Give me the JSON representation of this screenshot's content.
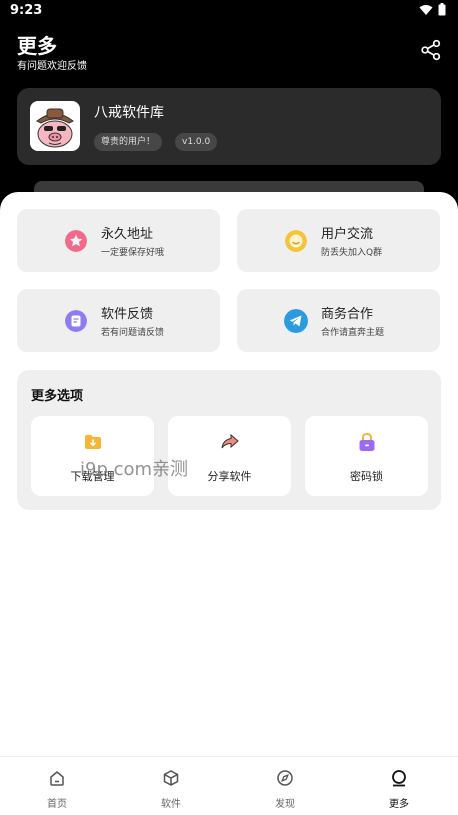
{
  "status_bar": {
    "time": "9:23"
  },
  "header": {
    "title": "更多",
    "subtitle": "有问题欢迎反馈"
  },
  "profile": {
    "name": "八戒软件库",
    "badge": "尊贵的用户！",
    "version": "v1.0.0"
  },
  "features": [
    {
      "title": "永久地址",
      "subtitle": "一定要保存好哦",
      "icon": "star-icon",
      "color": "#f06a8c"
    },
    {
      "title": "用户交流",
      "subtitle": "防丢失加入Q群",
      "icon": "smile-icon",
      "color": "#f3c43c"
    },
    {
      "title": "软件反馈",
      "subtitle": "若有问题请反馈",
      "icon": "feedback-icon",
      "color": "#8e7cf0"
    },
    {
      "title": "商务合作",
      "subtitle": "合作请直奔主题",
      "icon": "telegram-icon",
      "color": "#2a9be0"
    }
  ],
  "more_options": {
    "title": "更多选项",
    "items": [
      {
        "label": "下载管理",
        "icon": "download-folder-icon",
        "color": "#f5b638"
      },
      {
        "label": "分享软件",
        "icon": "share-arrow-icon",
        "color": "#ef8b7f"
      },
      {
        "label": "密码锁",
        "icon": "lock-icon",
        "color": "#9b6cf0"
      }
    ]
  },
  "watermark": "i9p.com亲测",
  "bottom_nav": [
    {
      "label": "首页",
      "icon": "home-icon"
    },
    {
      "label": "软件",
      "icon": "cube-icon"
    },
    {
      "label": "发现",
      "icon": "compass-icon"
    },
    {
      "label": "更多",
      "icon": "more-icon",
      "active": true
    }
  ]
}
